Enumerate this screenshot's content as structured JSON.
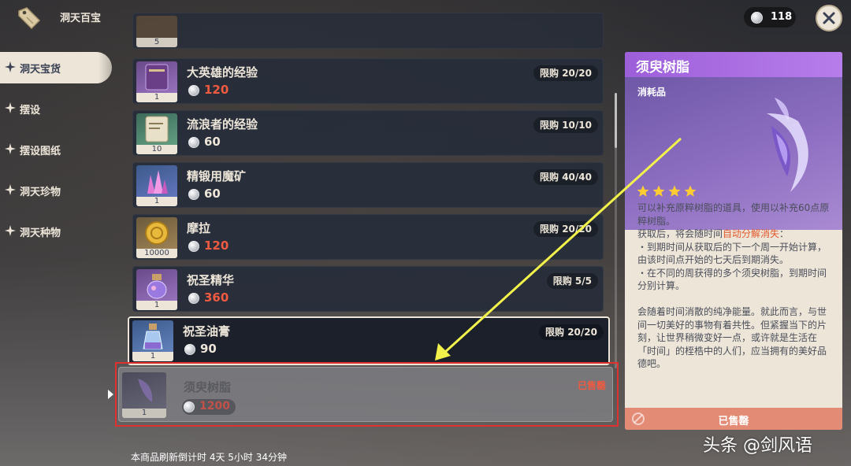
{
  "header": {
    "title": "洞天百宝",
    "currency": "118"
  },
  "sidebar": {
    "items": [
      {
        "label": "洞天宝货"
      },
      {
        "label": "摆设"
      },
      {
        "label": "摆设图纸"
      },
      {
        "label": "洞天珍物"
      },
      {
        "label": "洞天种物"
      }
    ]
  },
  "list": {
    "partial_qty": "5",
    "items": [
      {
        "name": "大英雄的经验",
        "price": "120",
        "limit": "限购 20/20",
        "qty": "1"
      },
      {
        "name": "流浪者的经验",
        "price": "60",
        "limit": "限购 10/10",
        "qty": "10"
      },
      {
        "name": "精锻用魔矿",
        "price": "60",
        "limit": "限购 40/40",
        "qty": "1"
      },
      {
        "name": "摩拉",
        "price": "120",
        "limit": "限购 20/20",
        "qty": "10000"
      },
      {
        "name": "祝圣精华",
        "price": "360",
        "limit": "限购 5/5",
        "qty": "1"
      },
      {
        "name": "祝圣油膏",
        "price": "90",
        "limit": "限购 20/20",
        "qty": "1"
      },
      {
        "name": "须臾树脂",
        "price": "1200",
        "status": "已售罄",
        "qty": "1"
      }
    ]
  },
  "detail": {
    "title": "须臾树脂",
    "category": "消耗品",
    "rarity": 4,
    "desc": {
      "p1": "可以补充原粹树脂的道具，使用以补充60点原粹树脂。",
      "p2_pre": "获取后，将会随时间",
      "p2_hl": "自动分解消失",
      "p2_post": "：",
      "p3": "・到期时间从获取后的下一个周一开始计算，由该时间点开始的七天后到期消失。",
      "p4": "・在不同的周获得的多个须臾树脂，到期时间分别计算。",
      "p5": "会随着时间消散的纯净能量。就此而言，与世间一切美好的事物有着共性。但紧握当下的片刻，让世界稍微变好一点，或许就是生活在「时间」的桎梏中的人们，应当拥有的美好品德吧。"
    },
    "sold_label": "已售罄"
  },
  "footer": {
    "refresh": "本商品刷新倒计时 4天 5小时 34分钟"
  },
  "watermark": "头条 @剑风语",
  "colors": {
    "accent_purple": "#9d5fd9",
    "price_red": "#f05a41",
    "annotation_red": "#e03030",
    "annotation_arrow": "#f2f24a"
  }
}
